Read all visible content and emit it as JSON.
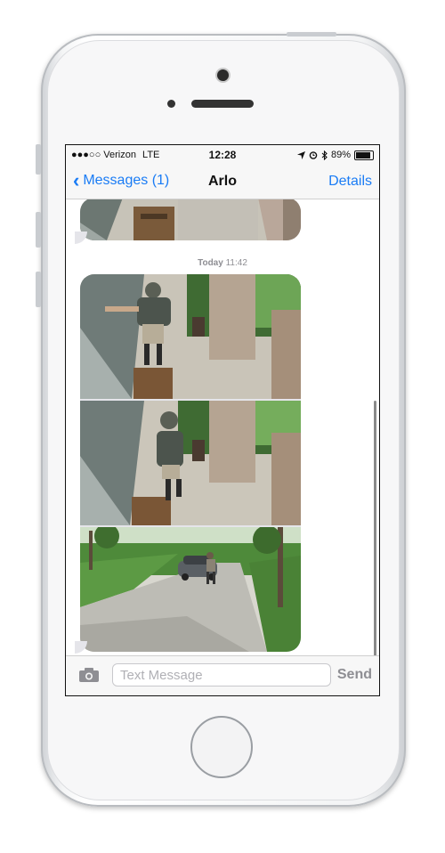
{
  "status_bar": {
    "carrier": "●●●○○ Verizon",
    "network": "LTE",
    "time": "12:28",
    "battery": "89%",
    "battery_level": 0.89
  },
  "nav": {
    "back_label": "Messages (1)",
    "title": "Arlo",
    "details_label": "Details"
  },
  "chat": {
    "timestamp_day": "Today",
    "timestamp_time": "11:42"
  },
  "input": {
    "placeholder": "Text Message",
    "send_label": "Send"
  },
  "icons": {
    "back": "chevron-left-icon",
    "camera": "camera-icon",
    "location": "location-arrow-icon",
    "alarm": "alarm-clock-icon",
    "bluetooth": "bluetooth-icon",
    "battery": "battery-icon"
  },
  "colors": {
    "accent": "#1a7cf5",
    "bubble": "#e5e5ea"
  }
}
